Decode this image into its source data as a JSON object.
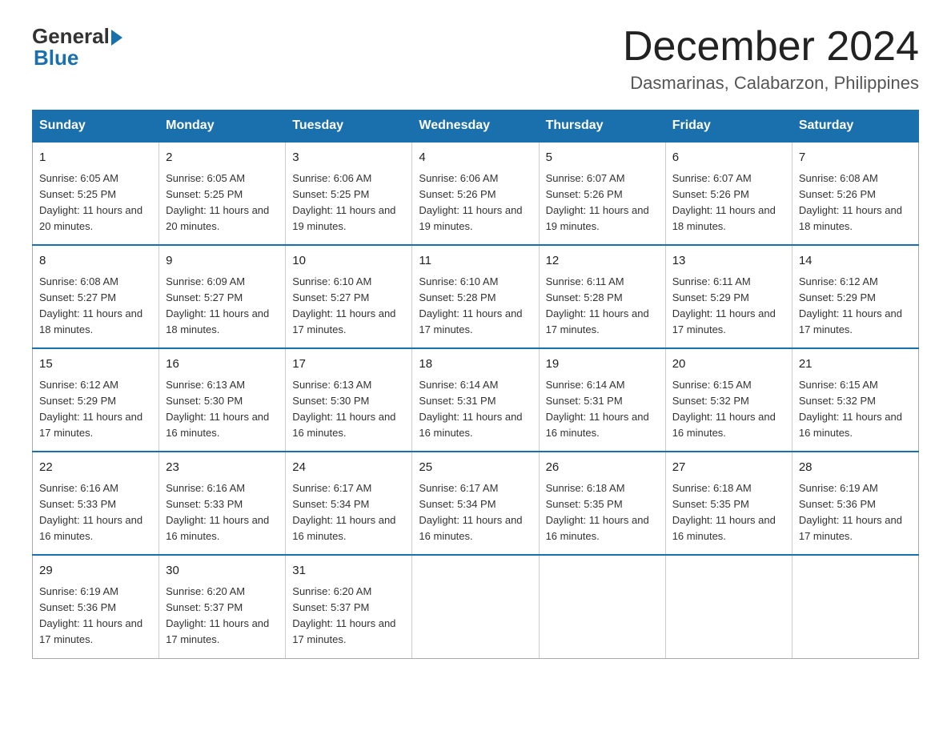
{
  "header": {
    "logo_general": "General",
    "logo_blue": "Blue",
    "month_title": "December 2024",
    "location": "Dasmarinas, Calabarzon, Philippines"
  },
  "days_of_week": [
    "Sunday",
    "Monday",
    "Tuesday",
    "Wednesday",
    "Thursday",
    "Friday",
    "Saturday"
  ],
  "weeks": [
    [
      {
        "day": "1",
        "sunrise": "6:05 AM",
        "sunset": "5:25 PM",
        "daylight": "11 hours and 20 minutes."
      },
      {
        "day": "2",
        "sunrise": "6:05 AM",
        "sunset": "5:25 PM",
        "daylight": "11 hours and 20 minutes."
      },
      {
        "day": "3",
        "sunrise": "6:06 AM",
        "sunset": "5:25 PM",
        "daylight": "11 hours and 19 minutes."
      },
      {
        "day": "4",
        "sunrise": "6:06 AM",
        "sunset": "5:26 PM",
        "daylight": "11 hours and 19 minutes."
      },
      {
        "day": "5",
        "sunrise": "6:07 AM",
        "sunset": "5:26 PM",
        "daylight": "11 hours and 19 minutes."
      },
      {
        "day": "6",
        "sunrise": "6:07 AM",
        "sunset": "5:26 PM",
        "daylight": "11 hours and 18 minutes."
      },
      {
        "day": "7",
        "sunrise": "6:08 AM",
        "sunset": "5:26 PM",
        "daylight": "11 hours and 18 minutes."
      }
    ],
    [
      {
        "day": "8",
        "sunrise": "6:08 AM",
        "sunset": "5:27 PM",
        "daylight": "11 hours and 18 minutes."
      },
      {
        "day": "9",
        "sunrise": "6:09 AM",
        "sunset": "5:27 PM",
        "daylight": "11 hours and 18 minutes."
      },
      {
        "day": "10",
        "sunrise": "6:10 AM",
        "sunset": "5:27 PM",
        "daylight": "11 hours and 17 minutes."
      },
      {
        "day": "11",
        "sunrise": "6:10 AM",
        "sunset": "5:28 PM",
        "daylight": "11 hours and 17 minutes."
      },
      {
        "day": "12",
        "sunrise": "6:11 AM",
        "sunset": "5:28 PM",
        "daylight": "11 hours and 17 minutes."
      },
      {
        "day": "13",
        "sunrise": "6:11 AM",
        "sunset": "5:29 PM",
        "daylight": "11 hours and 17 minutes."
      },
      {
        "day": "14",
        "sunrise": "6:12 AM",
        "sunset": "5:29 PM",
        "daylight": "11 hours and 17 minutes."
      }
    ],
    [
      {
        "day": "15",
        "sunrise": "6:12 AM",
        "sunset": "5:29 PM",
        "daylight": "11 hours and 17 minutes."
      },
      {
        "day": "16",
        "sunrise": "6:13 AM",
        "sunset": "5:30 PM",
        "daylight": "11 hours and 16 minutes."
      },
      {
        "day": "17",
        "sunrise": "6:13 AM",
        "sunset": "5:30 PM",
        "daylight": "11 hours and 16 minutes."
      },
      {
        "day": "18",
        "sunrise": "6:14 AM",
        "sunset": "5:31 PM",
        "daylight": "11 hours and 16 minutes."
      },
      {
        "day": "19",
        "sunrise": "6:14 AM",
        "sunset": "5:31 PM",
        "daylight": "11 hours and 16 minutes."
      },
      {
        "day": "20",
        "sunrise": "6:15 AM",
        "sunset": "5:32 PM",
        "daylight": "11 hours and 16 minutes."
      },
      {
        "day": "21",
        "sunrise": "6:15 AM",
        "sunset": "5:32 PM",
        "daylight": "11 hours and 16 minutes."
      }
    ],
    [
      {
        "day": "22",
        "sunrise": "6:16 AM",
        "sunset": "5:33 PM",
        "daylight": "11 hours and 16 minutes."
      },
      {
        "day": "23",
        "sunrise": "6:16 AM",
        "sunset": "5:33 PM",
        "daylight": "11 hours and 16 minutes."
      },
      {
        "day": "24",
        "sunrise": "6:17 AM",
        "sunset": "5:34 PM",
        "daylight": "11 hours and 16 minutes."
      },
      {
        "day": "25",
        "sunrise": "6:17 AM",
        "sunset": "5:34 PM",
        "daylight": "11 hours and 16 minutes."
      },
      {
        "day": "26",
        "sunrise": "6:18 AM",
        "sunset": "5:35 PM",
        "daylight": "11 hours and 16 minutes."
      },
      {
        "day": "27",
        "sunrise": "6:18 AM",
        "sunset": "5:35 PM",
        "daylight": "11 hours and 16 minutes."
      },
      {
        "day": "28",
        "sunrise": "6:19 AM",
        "sunset": "5:36 PM",
        "daylight": "11 hours and 17 minutes."
      }
    ],
    [
      {
        "day": "29",
        "sunrise": "6:19 AM",
        "sunset": "5:36 PM",
        "daylight": "11 hours and 17 minutes."
      },
      {
        "day": "30",
        "sunrise": "6:20 AM",
        "sunset": "5:37 PM",
        "daylight": "11 hours and 17 minutes."
      },
      {
        "day": "31",
        "sunrise": "6:20 AM",
        "sunset": "5:37 PM",
        "daylight": "11 hours and 17 minutes."
      },
      null,
      null,
      null,
      null
    ]
  ],
  "labels": {
    "sunrise": "Sunrise:",
    "sunset": "Sunset:",
    "daylight": "Daylight:"
  }
}
